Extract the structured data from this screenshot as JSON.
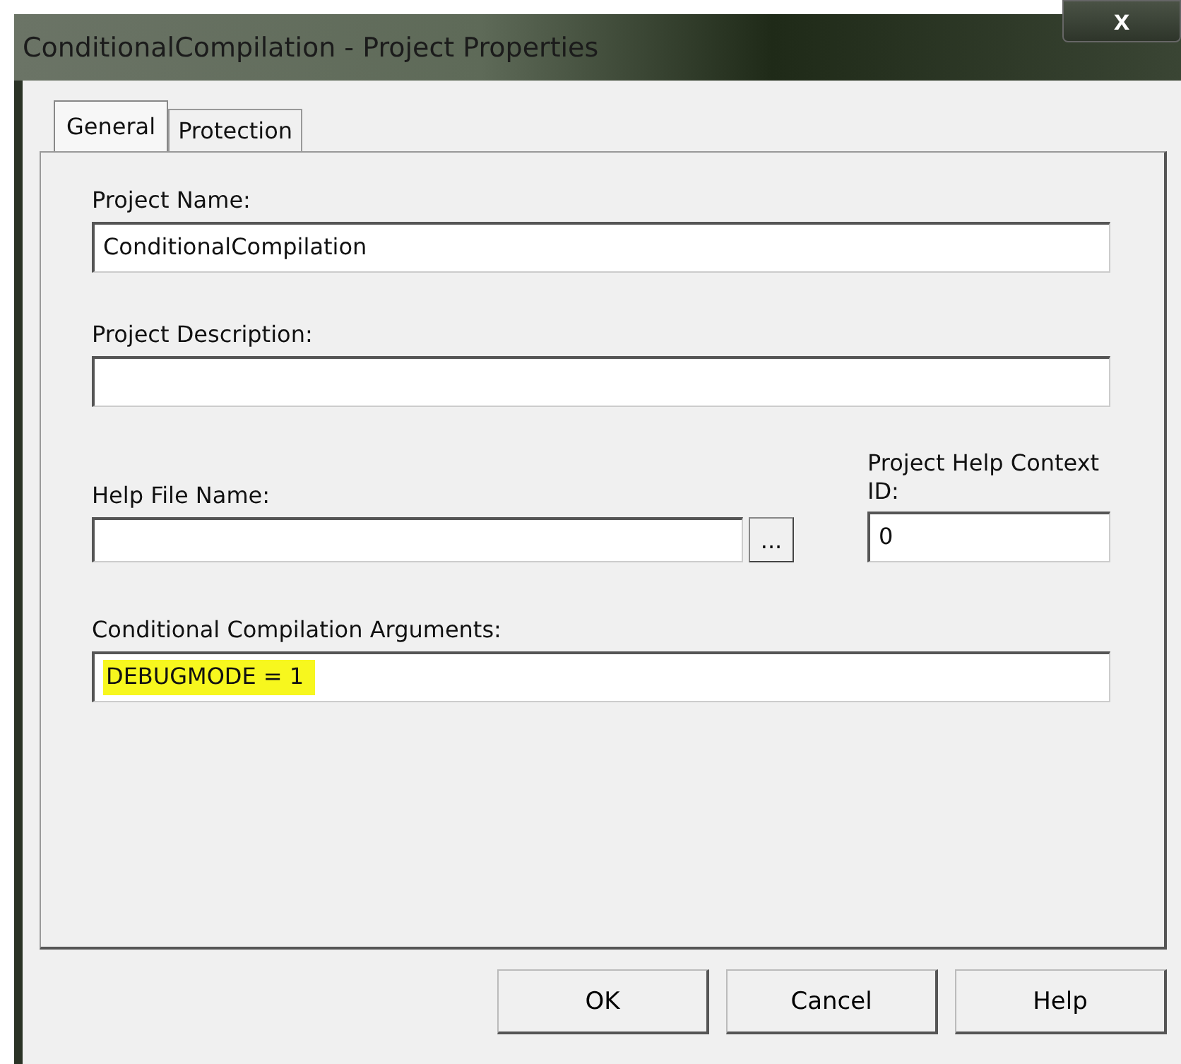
{
  "window": {
    "title": "ConditionalCompilation - Project Properties",
    "close": "x"
  },
  "tabs": [
    {
      "label": "General",
      "selected": true
    },
    {
      "label": "Protection",
      "selected": false
    }
  ],
  "fields": {
    "project_name": {
      "label": "Project Name:",
      "value": "ConditionalCompilation"
    },
    "project_description": {
      "label": "Project Description:"
    },
    "help_file_name": {
      "label": "Help File Name:",
      "browse": "..."
    },
    "help_context_id": {
      "label": "Project Help Context ID:",
      "value": "0"
    },
    "arguments": {
      "label": "Conditional Compilation Arguments:",
      "value": "DEBUGMODE = 1",
      "highlighted": true
    }
  },
  "buttons": [
    "OK",
    "Cancel",
    "Help"
  ]
}
